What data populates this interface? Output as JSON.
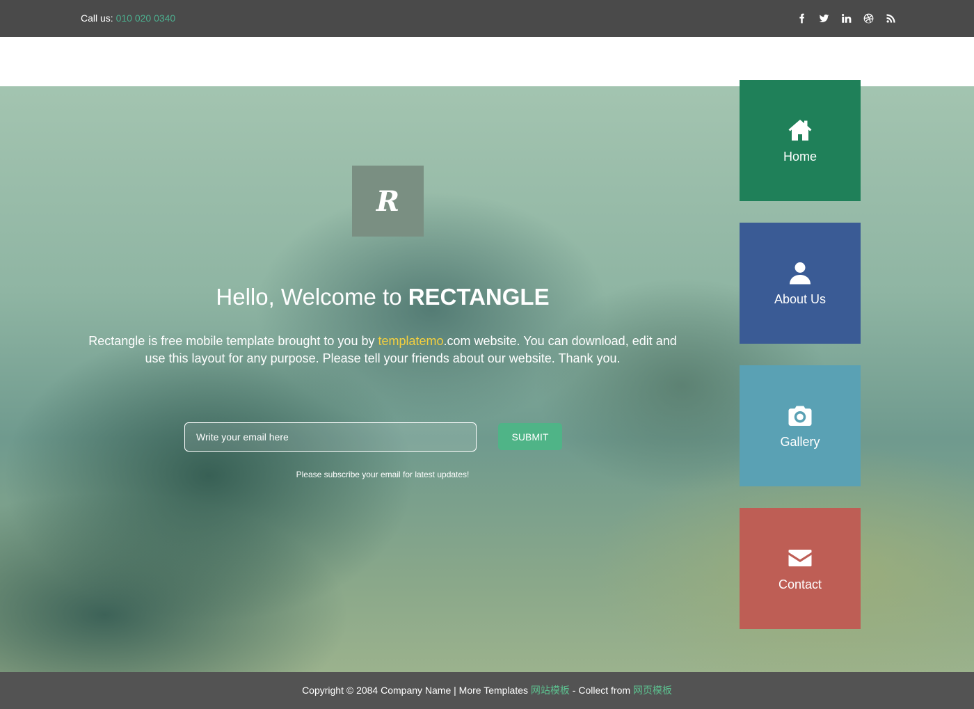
{
  "topbar": {
    "call_label": "Call us:",
    "phone": "010 020 0340",
    "social": [
      {
        "name": "facebook-icon"
      },
      {
        "name": "twitter-icon"
      },
      {
        "name": "linkedin-icon"
      },
      {
        "name": "dribbble-icon"
      },
      {
        "name": "rss-icon"
      }
    ]
  },
  "hero": {
    "logo_letter": "R",
    "headline_prefix": "Hello, Welcome to ",
    "headline_brand": "RECTANGLE",
    "desc_part1": "Rectangle is free mobile template brought to you by ",
    "desc_link": "templatemo",
    "desc_part2": ".com website. You can download, edit and use this layout for any purpose. Please tell your friends about our website. Thank you.",
    "email_placeholder": "Write your email here",
    "submit_label": "SUBMIT",
    "note": "Please subscribe your email for latest updates!"
  },
  "nav": {
    "home": "Home",
    "about": "About Us",
    "gallery": "Gallery",
    "contact": "Contact"
  },
  "colors": {
    "home": "#1f8059",
    "about": "#3a5b95",
    "gallery": "#5aa1b4",
    "contact": "#be5e55",
    "accent_green": "#4fb487",
    "highlight_yellow": "#f4d03f"
  },
  "footer": {
    "copyright": "Copyright © 2084 Company Name | More Templates ",
    "link1": "网站模板",
    "middle": " - Collect from ",
    "link2": "网页模板"
  }
}
